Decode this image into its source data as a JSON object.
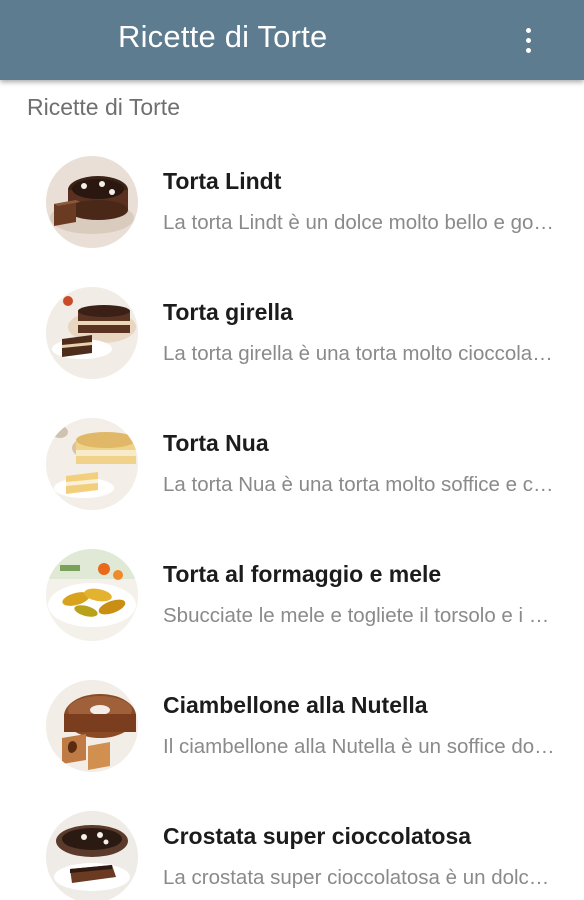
{
  "appbar": {
    "title": "Ricette di Torte",
    "overflow_icon": "more-vert-icon",
    "color": "#5d7c8f"
  },
  "section": {
    "header": "Ricette di Torte"
  },
  "recipes": [
    {
      "title": "Torta Lindt",
      "description": "La torta Lindt è un dolce molto bello e goloso",
      "image": "chocolate-cake-photo"
    },
    {
      "title": "Torta girella",
      "description": "La torta girella è una torta molto cioccolatosa",
      "image": "swirl-cake-photo"
    },
    {
      "title": "Torta Nua",
      "description": "La torta Nua è una torta molto soffice e cremosa",
      "image": "cream-cake-photo"
    },
    {
      "title": "Torta al formaggio e mele",
      "description": "Sbucciate le mele e togliete il torsolo e i semi",
      "image": "apple-cheese-cake-photo"
    },
    {
      "title": "Ciambellone alla Nutella",
      "description": "Il ciambellone alla Nutella è un soffice dolce",
      "image": "nutella-bundt-cake-photo"
    },
    {
      "title": "Crostata super cioccolatosa",
      "description": "La crostata super cioccolatosa è un dolce goloso",
      "image": "chocolate-tart-photo"
    }
  ]
}
